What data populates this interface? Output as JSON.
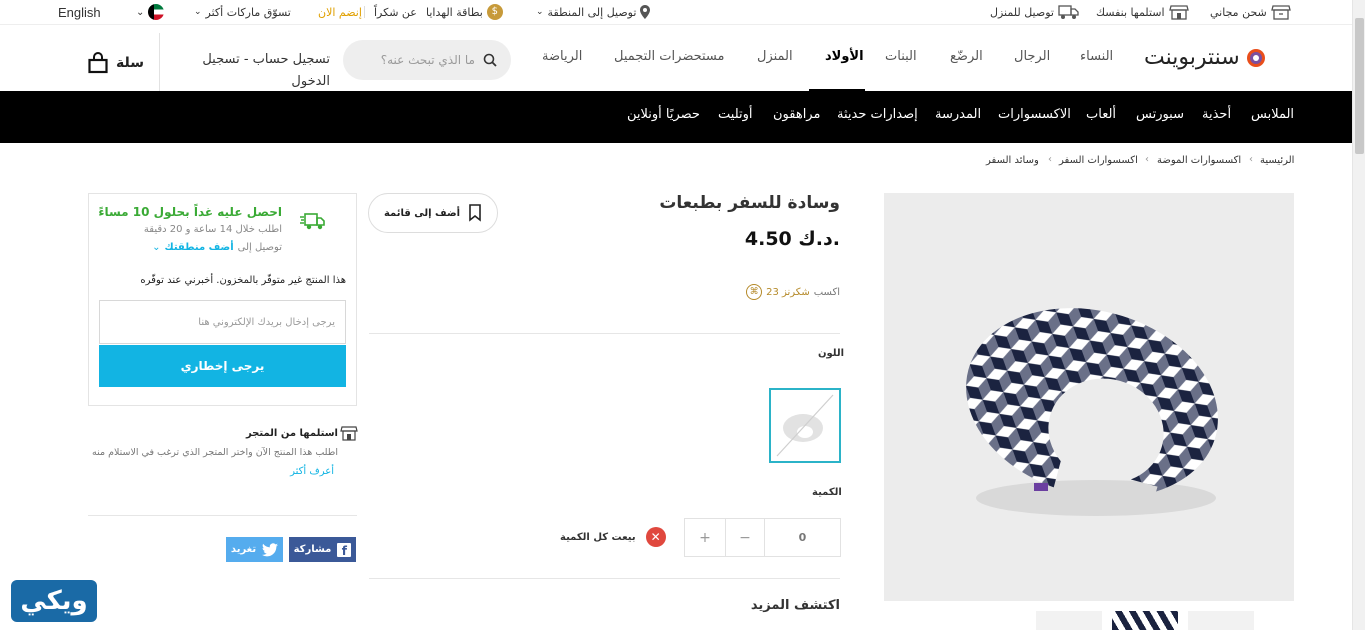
{
  "utility_bar": {
    "language": "English",
    "shop_brands": "تسوّق ماركات أكثر",
    "join_now": "إنضم الان",
    "thank_you": "عن شكراً",
    "gift_card": "بطاقة الهدايا",
    "deliver_to": "توصيل إلى المنطقة",
    "home_delivery": "توصيل للمنزل",
    "click_collect": "استلمها بنفسك",
    "free_shipping": "شحن مجاني"
  },
  "header": {
    "logo": "سنتربوينت",
    "nav": [
      "النساء",
      "الرجال",
      "الرضّع",
      "البنات",
      "الأولاد",
      "المنزل",
      "مستحضرات التجميل",
      "الرياضة"
    ],
    "active_nav": "الأولاد",
    "search_placeholder": "ما الذي تبحث عنه؟",
    "login_line1": "تسجيل حساب - تسجيل",
    "login_line2": "الدخول",
    "basket": "سلة"
  },
  "category_bar": [
    "الملابس",
    "أحذية",
    "سبورتس",
    "ألعاب",
    "الاكسسوارات",
    "المدرسة",
    "إصدارات حديثة",
    "مراهقون",
    "أوتليت",
    "حصريًا أونلاين"
  ],
  "breadcrumb": [
    "الرئيسية",
    "اكسسوارات الموضة",
    "اكسسوارات السفر",
    "وسائد السفر"
  ],
  "product": {
    "title": "وسادة للسفر بطبعات",
    "price": "4.50 د.ك.",
    "earn_prefix": "اكسب",
    "earn_points": "23 شكرنز",
    "wishlist": "أضف إلى قائمة",
    "color_label": "اللون",
    "quantity_label": "الكمية",
    "quantity_value": "0",
    "plus": "+",
    "minus": "−",
    "sold_out": "بيعت كل الكمية",
    "discover_more": "اكتشف المزيد"
  },
  "delivery": {
    "headline": "احصل عليه غداً بحلول 10 مساءً",
    "order_within": "اطلب خلال 14 ساعة و 20 دقيقة",
    "deliver_to": "توصيل إلى",
    "add_area": "أضف منطقتك",
    "out_of_stock": "هذا المنتج غير متوفّر بالمخزون. أخبرني عند توفّره",
    "email_placeholder": "يرجى إدخال بريدك الإلكتروني هنا",
    "notify_button": "يرجى إخطاري"
  },
  "store_pickup": {
    "title": "استلمها من المتجر",
    "desc": "اطلب هذا المنتج الآن واختر المتجر الذي ترغب في الاستلام منه",
    "learn_more": "أعرف أكثر"
  },
  "share": {
    "facebook": "مشاركة",
    "twitter": "تغريد"
  },
  "watermark": "ويكي",
  "colors": {
    "accent": "#12b4e3",
    "green": "#3aaa35",
    "facebook": "#3b5998",
    "twitter": "#55acee",
    "sold_out": "#e0483e",
    "swatch_border": "#2bb3c8"
  }
}
